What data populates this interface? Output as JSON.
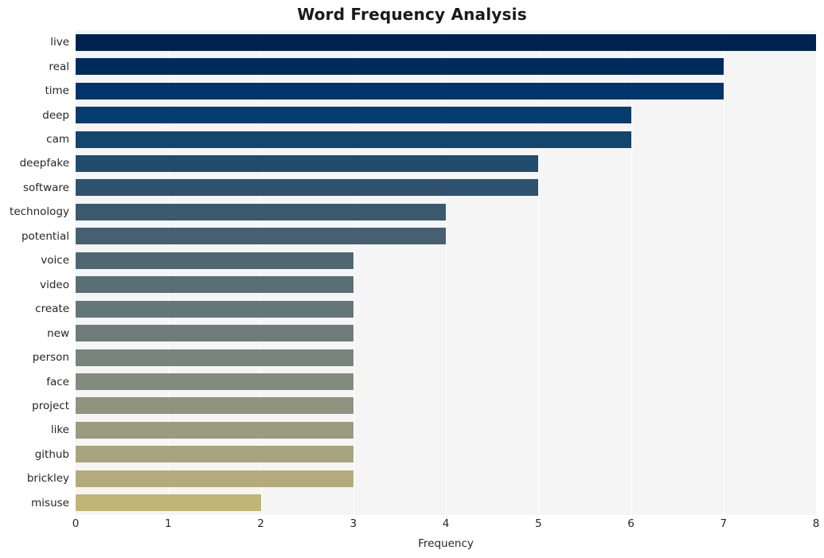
{
  "chart_data": {
    "type": "bar",
    "orientation": "horizontal",
    "title": "Word Frequency Analysis",
    "xlabel": "Frequency",
    "ylabel": "",
    "categories": [
      "live",
      "real",
      "time",
      "deep",
      "cam",
      "deepfake",
      "software",
      "technology",
      "potential",
      "voice",
      "video",
      "create",
      "new",
      "person",
      "face",
      "project",
      "like",
      "github",
      "brickley",
      "misuse"
    ],
    "values": [
      8,
      7,
      7,
      6,
      6,
      5,
      5,
      4,
      4,
      3,
      3,
      3,
      3,
      3,
      3,
      3,
      3,
      3,
      3,
      2
    ],
    "xlim": [
      0,
      8
    ],
    "xticks": [
      "0",
      "1",
      "2",
      "3",
      "4",
      "5",
      "6",
      "7",
      "8"
    ],
    "xtick_values": [
      0,
      1,
      2,
      3,
      4,
      5,
      6,
      7,
      8
    ],
    "grid": "vertical-white-on-gray",
    "legend": "none",
    "colormap": "cividis",
    "bar_colors": [
      "#00224e",
      "#1a3568",
      "#1d3c6d",
      "#424c६d",
      "#434e6e",
      "#5b6069",
      "#5d6269",
      "#7c7b78",
      "#7e7d79",
      "#999279",
      "#9b9479",
      "#9c9579",
      "#9d9678",
      "#9e9777",
      "#9f9877",
      "#a09976",
      "#a19a76",
      "#a29b75",
      "#a39c74",
      "#bfb25f"
    ],
    "plot_background": "#f5f5f6",
    "figure_background": "#ffffff",
    "text_color": "#262626"
  }
}
